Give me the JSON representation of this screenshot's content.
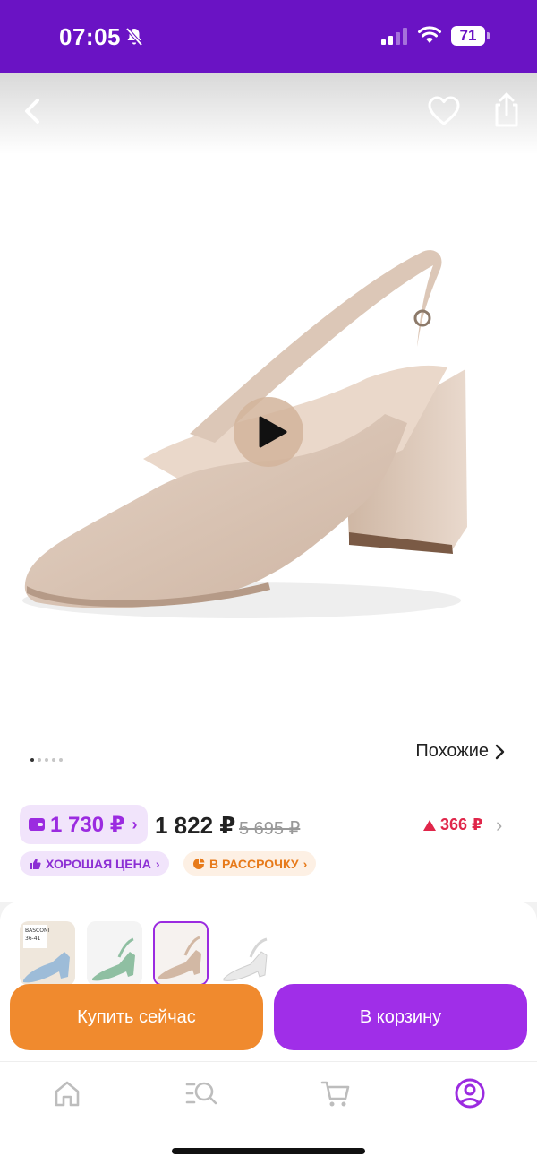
{
  "status_bar": {
    "time": "07:05",
    "battery": "71",
    "icons": [
      "bell-off-icon",
      "signal-icon",
      "wifi-icon",
      "battery-icon"
    ]
  },
  "nav": {
    "icons": [
      "chevron-left-icon",
      "heart-icon",
      "share-icon"
    ]
  },
  "gallery": {
    "similar_label": "Похожие",
    "total_dots": 5,
    "active_dot": 0
  },
  "price": {
    "wallet_price": "1 730 ₽",
    "main_price": "1 822 ₽",
    "old_price": "5 695 ₽",
    "drop_value": "366 ₽",
    "tags": {
      "good": "ХОРОШАЯ ЦЕНА",
      "installment": "В РАССРОЧКУ"
    }
  },
  "variants": {
    "thumbs": [
      {
        "color": "blue",
        "title": "BASCONI",
        "size": "36-41"
      },
      {
        "color": "green"
      },
      {
        "color": "beige",
        "selected": true
      },
      {
        "color": "white"
      }
    ]
  },
  "actions": {
    "buy_now": "Купить сейчас",
    "add_to_cart": "В корзину"
  },
  "tab_bar": {
    "items": [
      "home-icon",
      "catalog-search-icon",
      "cart-icon",
      "profile-icon"
    ],
    "active_index": 3
  },
  "colors": {
    "brand_purple": "#6a13c4",
    "accent_purple": "#a02ee8",
    "orange": "#f08a2e",
    "price_drop_red": "#e0264a"
  }
}
